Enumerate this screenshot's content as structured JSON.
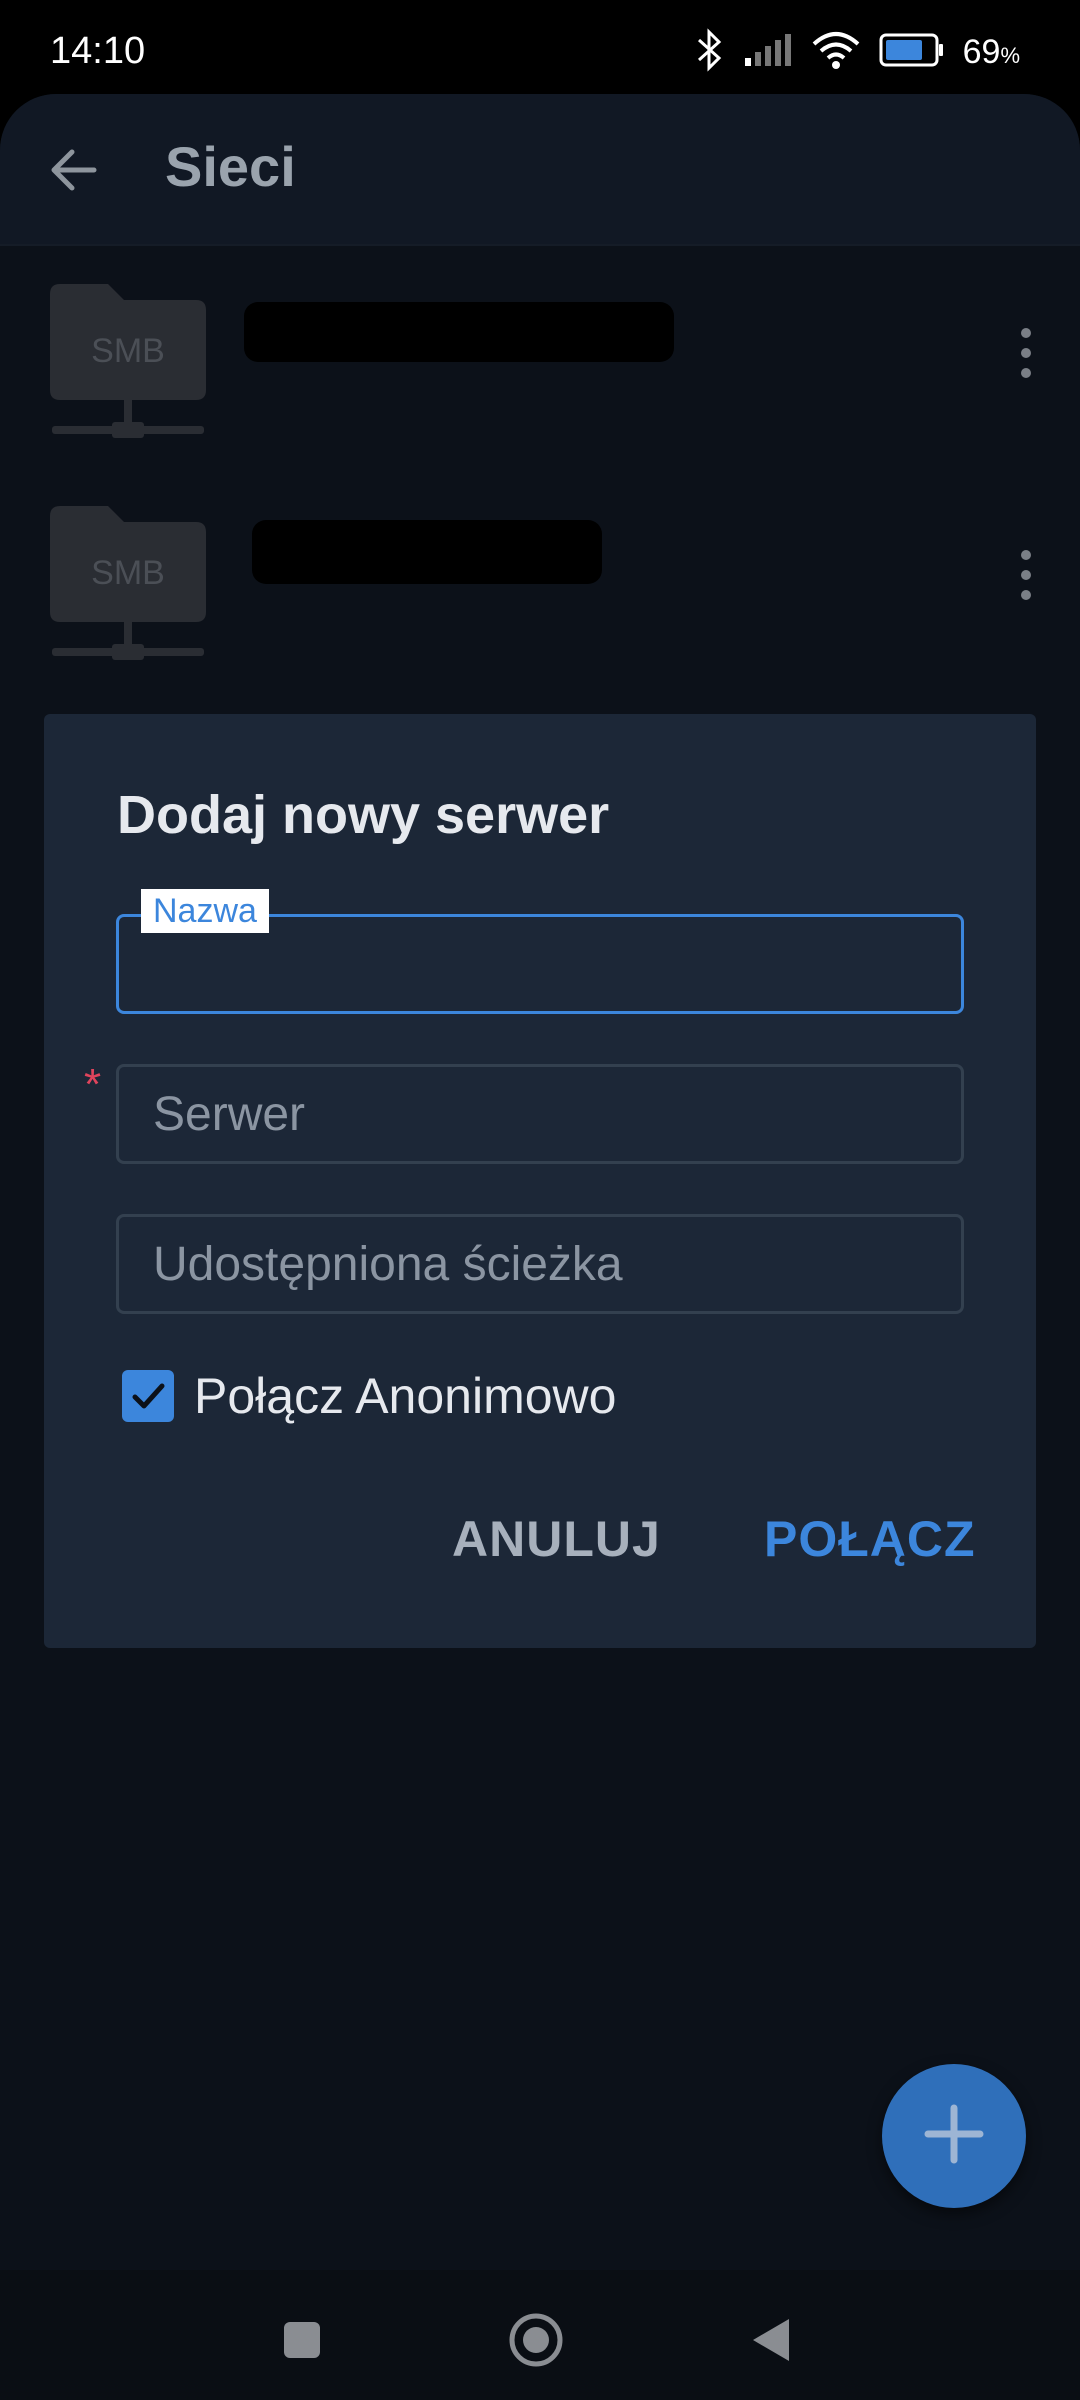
{
  "status_bar": {
    "time": "14:10",
    "battery_percent": "69",
    "battery_unit": "%",
    "icons": [
      "bluetooth-icon",
      "signal-icon",
      "wifi-icon",
      "battery-icon"
    ]
  },
  "app_bar": {
    "title": "Sieci",
    "back_icon": "arrow-left-icon"
  },
  "networks": [
    {
      "icon_label": "SMB",
      "name_redacted": true,
      "menu_icon": "more-vertical-icon"
    },
    {
      "icon_label": "SMB",
      "name_redacted": true,
      "menu_icon": "more-vertical-icon"
    }
  ],
  "dialog": {
    "title": "Dodaj nowy serwer",
    "fields": {
      "name": {
        "label": "Nazwa",
        "value": "",
        "placeholder": ""
      },
      "server": {
        "value": "",
        "placeholder": "Serwer",
        "required_mark": "*"
      },
      "share_path": {
        "value": "",
        "placeholder": "Udostępniona ścieżka"
      }
    },
    "anonymous": {
      "label": "Połącz Anonimowo",
      "checked": true
    },
    "buttons": {
      "cancel": "ANULUJ",
      "connect": "POŁĄCZ"
    }
  },
  "fab": {
    "icon": "plus-icon"
  },
  "nav": {
    "icons": [
      "recents-square-icon",
      "home-circle-icon",
      "back-triangle-icon"
    ]
  },
  "colors": {
    "accent": "#3c86dc",
    "dialog_bg": "#1c2737",
    "app_bg": "#0c1119",
    "required": "#e0445c"
  }
}
